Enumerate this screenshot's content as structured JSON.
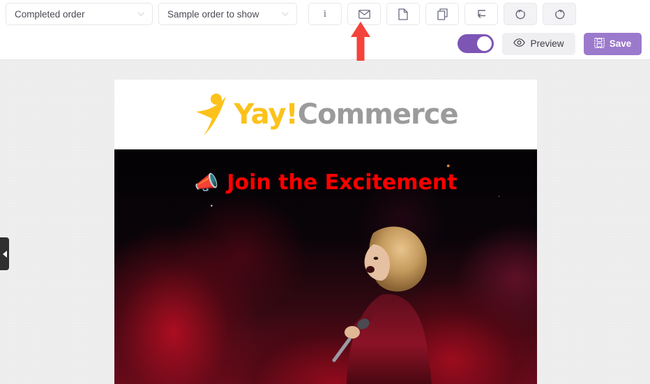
{
  "header": {
    "order_status_select": {
      "value": "Completed order",
      "icon": "chevron-down-icon"
    },
    "sample_order_select": {
      "value": "Sample order to show",
      "icon": "chevron-down-icon"
    },
    "tool_buttons": [
      {
        "name": "info-button",
        "icon": "info-icon",
        "label": "i",
        "shaded": false
      },
      {
        "name": "email-button",
        "icon": "envelope-icon",
        "label": "",
        "shaded": false
      },
      {
        "name": "page-button",
        "icon": "page-icon",
        "label": "",
        "shaded": false
      },
      {
        "name": "duplicate-button",
        "icon": "duplicate-icon",
        "label": "",
        "shaded": false
      },
      {
        "name": "reply-button",
        "icon": "reply-arrow-icon",
        "label": "",
        "shaded": false
      },
      {
        "name": "undo-button",
        "icon": "undo-icon",
        "label": "",
        "shaded": true
      },
      {
        "name": "redo-button",
        "icon": "redo-icon",
        "label": "",
        "shaded": true
      }
    ],
    "toggle": {
      "name": "enable-toggle",
      "state": "on",
      "color": "#7d55b5"
    },
    "preview_button": {
      "label": "Preview",
      "icon": "eye-icon"
    },
    "save_button": {
      "label": "Save",
      "icon": "floppy-disk-icon",
      "color": "#9b79cc"
    }
  },
  "workspace": {
    "collapse_handle": {
      "name": "sidebar-collapse-handle",
      "icon": "chevron-left-icon"
    },
    "background_color": "#ededed"
  },
  "email_canvas": {
    "logo": {
      "mark": "yay-swoosh-icon",
      "primary_text": "Yay!",
      "primary_color": "#fcc21b",
      "secondary_text": "Commerce",
      "secondary_color": "#9b9b9b"
    },
    "hero": {
      "background_color": "#000000",
      "megaphone_icon": "📣",
      "headline": "Join the Excitement",
      "headline_color": "#ff0000",
      "image_alt": "concert performer singing into microphone with red stage smoke"
    }
  },
  "annotation": {
    "arrow": {
      "name": "red-annotation-arrow",
      "direction": "up",
      "color": "#f4433a",
      "points_at": "email-button"
    }
  }
}
